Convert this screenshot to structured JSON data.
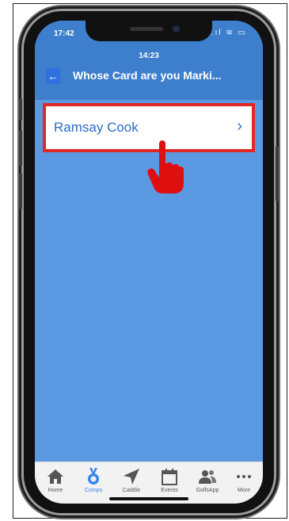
{
  "status_bar": {
    "time": "17:42",
    "icons": "..ıl ≋ ▭"
  },
  "header": {
    "time": "14:23",
    "back_icon": "←",
    "title": "Whose Card are you Marki..."
  },
  "list": {
    "items": [
      {
        "label": "Ramsay Cook",
        "chevron": "›"
      }
    ]
  },
  "tabbar": {
    "items": [
      {
        "label": "Home",
        "icon": "home-icon"
      },
      {
        "label": "Comps",
        "icon": "medal-icon",
        "active": true
      },
      {
        "label": "Caddie",
        "icon": "navigation-arrow-icon"
      },
      {
        "label": "Events",
        "icon": "calendar-icon"
      },
      {
        "label": "GolfsApp",
        "icon": "people-icon"
      },
      {
        "label": "More",
        "icon": "more-dots-icon"
      }
    ]
  },
  "colors": {
    "header": "#3e7fcd",
    "background": "#5b9ae2",
    "highlight": "#e02828",
    "link": "#2b6cc4",
    "tab_active": "#3a86ea"
  }
}
